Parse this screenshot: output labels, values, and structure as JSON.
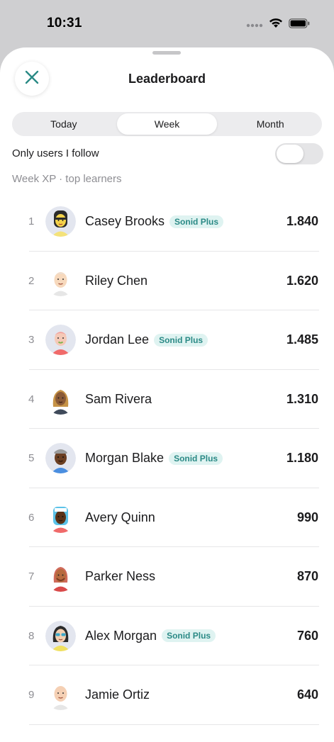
{
  "status_bar": {
    "time": "10:31"
  },
  "sheet": {
    "title": "Leaderboard",
    "close_icon": "close-icon",
    "accent": "#2a8a85"
  },
  "segments": [
    {
      "label": "Today",
      "active": false
    },
    {
      "label": "Week",
      "active": true
    },
    {
      "label": "Month",
      "active": false
    }
  ],
  "follow_toggle": {
    "label": "Only users I follow",
    "on": false
  },
  "subtitle": "Week XP · top learners",
  "badge_label": "Sonid Plus",
  "leaderboard": [
    {
      "rank": "1",
      "name": "Casey Brooks",
      "plus": true,
      "xp": "1.840"
    },
    {
      "rank": "2",
      "name": "Riley Chen",
      "plus": false,
      "xp": "1.620"
    },
    {
      "rank": "3",
      "name": "Jordan Lee",
      "plus": true,
      "xp": "1.485"
    },
    {
      "rank": "4",
      "name": "Sam Rivera",
      "plus": false,
      "xp": "1.310"
    },
    {
      "rank": "5",
      "name": "Morgan Blake",
      "plus": true,
      "xp": "1.180"
    },
    {
      "rank": "6",
      "name": "Avery Quinn",
      "plus": false,
      "xp": "990"
    },
    {
      "rank": "7",
      "name": "Parker Ness",
      "plus": false,
      "xp": "870"
    },
    {
      "rank": "8",
      "name": "Alex Morgan",
      "plus": true,
      "xp": "760"
    },
    {
      "rank": "9",
      "name": "Jamie Ortiz",
      "plus": false,
      "xp": "640"
    }
  ]
}
